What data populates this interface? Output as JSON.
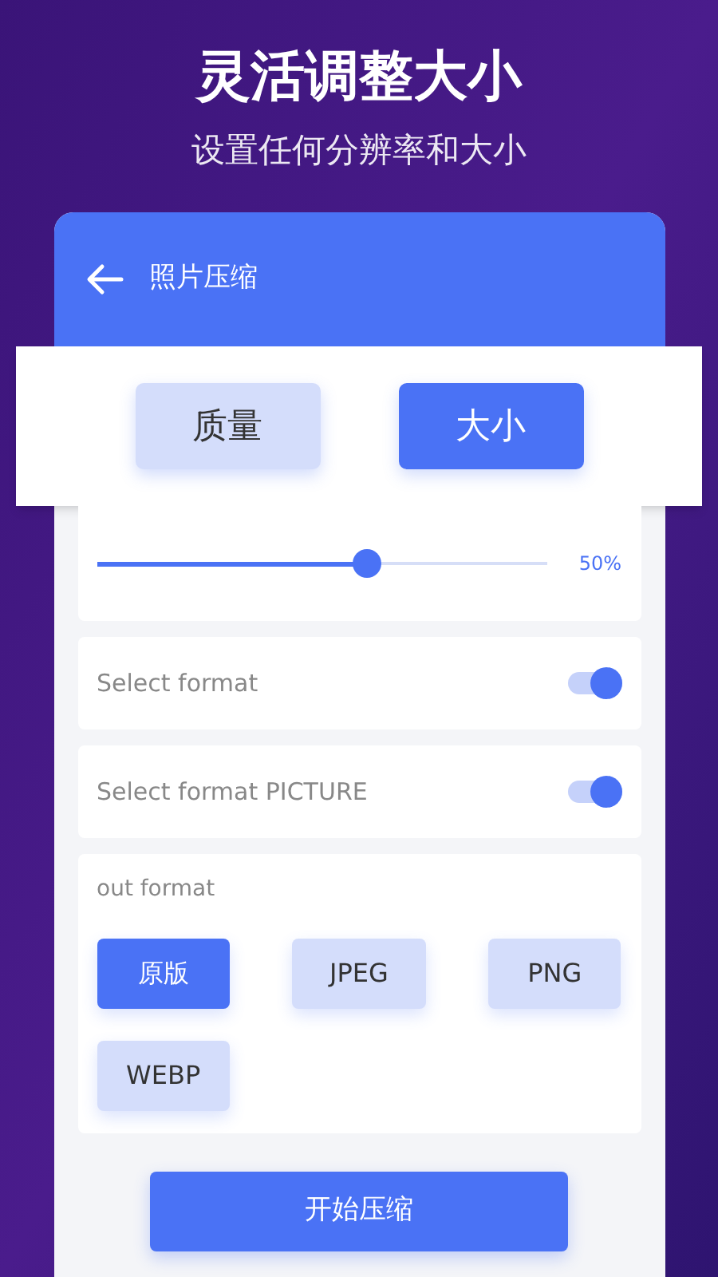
{
  "headline": "灵活调整大小",
  "subheadline": "设置任何分辨率和大小",
  "app_bar": {
    "title": "照片压缩"
  },
  "mode_tabs": [
    {
      "label": "质量",
      "selected": false
    },
    {
      "label": "大小",
      "selected": true
    }
  ],
  "size_slider": {
    "level": 0.6,
    "reading": "50%"
  },
  "toggles": [
    {
      "label": "Select format",
      "on": true
    },
    {
      "label": "Select format PICTURE",
      "on": true
    }
  ],
  "format_section": {
    "title": "out format",
    "options": [
      {
        "label": "原版",
        "selected": true
      },
      {
        "label": "JPEG",
        "selected": false
      },
      {
        "label": "PNG",
        "selected": false
      },
      {
        "label": "WEBP",
        "selected": false
      }
    ]
  },
  "start_button": "开始压缩"
}
